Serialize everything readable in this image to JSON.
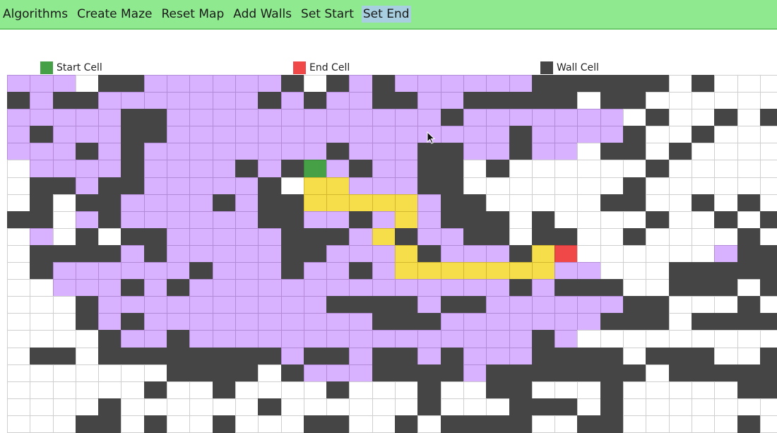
{
  "menu": {
    "items": [
      {
        "label": "Algorithms",
        "name": "menu-algorithms",
        "active": false
      },
      {
        "label": "Create Maze",
        "name": "menu-create-maze",
        "active": false
      },
      {
        "label": "Reset Map",
        "name": "menu-reset-map",
        "active": false
      },
      {
        "label": "Add Walls",
        "name": "menu-add-walls",
        "active": false
      },
      {
        "label": "Set Start",
        "name": "menu-set-start",
        "active": false
      },
      {
        "label": "Set End",
        "name": "menu-set-end",
        "active": true
      }
    ]
  },
  "legend": {
    "start": {
      "label": "Start Cell",
      "color": "#46a046"
    },
    "end": {
      "label": "End Cell",
      "color": "#f04848"
    },
    "wall": {
      "label": "Wall Cell",
      "color": "#454545"
    }
  },
  "colors": {
    "visited": "#d8b2ff",
    "path": "#f6dd4a",
    "empty": "#ffffff",
    "menubar": "#8fe98f",
    "active_menu": "#a8cfe0"
  },
  "grid": {
    "cols": 34,
    "legend_codes": {
      ".": "empty",
      "W": "wall",
      "V": "visited",
      "P": "path",
      "S": "start",
      "E": "end"
    },
    "rows": [
      "VVV.WWVVVVVVW.WVWVVVVVVWWWWWW.W...",
      "WVWWVVVVVVVWVWVVWWVVWWWWW.WW......",
      "VVVVVWWVVVVVVVVVVVVWVVVVVVV.W..W.W",
      "VWVVVWWVVVVVVVVVVVVVVVWVVVVW..W...",
      "VVVWVWVVVVVVVVWVVVWWVVWVV.WW.W....",
      ".VVVVWVVVVWVWSVWVVWW.W......W.....",
      ".WWVWWVVVVVW.PPVVVWW.......W......",
      ".W.WWVVVVWVWWPPPPPVWW.....WW..W.W.",
      "WW.VWVVVVVVWWVVWVPVWWW.W....W..W.W",
      ".V.W.WWVVVVVWWWVPWVVWW.WW..W....W.",
      ".WWWWVWVVVVVWWVVVPWVVVWPE......VWW",
      ".WVVVVVVWVVVWVVWVPPPPPPPVV...WWWWW",
      "..VVVWVWVVVVVVVVVVVVVVWVWWW..WWW.W",
      "...WVVVVVVVVVVWWWWVWWVVVVVVWW...W.",
      "...WVWVVVVVVVVVVWWWVVVVVVVWWW.WWWW",
      "....WVVWVVVVVVVVVVVVVVVWV.........",
      ".WW.WWWWWWWWVWWVWWVWVVVWWWW.WWW..W",
      ".......WWWW.WVVVWWWWVWWWWWWW.WWWWW",
      "......W..W....W...W..WW...W.....WW",
      "....W......W......W...WWW.W.......",
      "...WW.W..W...WW..W.WWWW..WW.....W."
    ]
  }
}
